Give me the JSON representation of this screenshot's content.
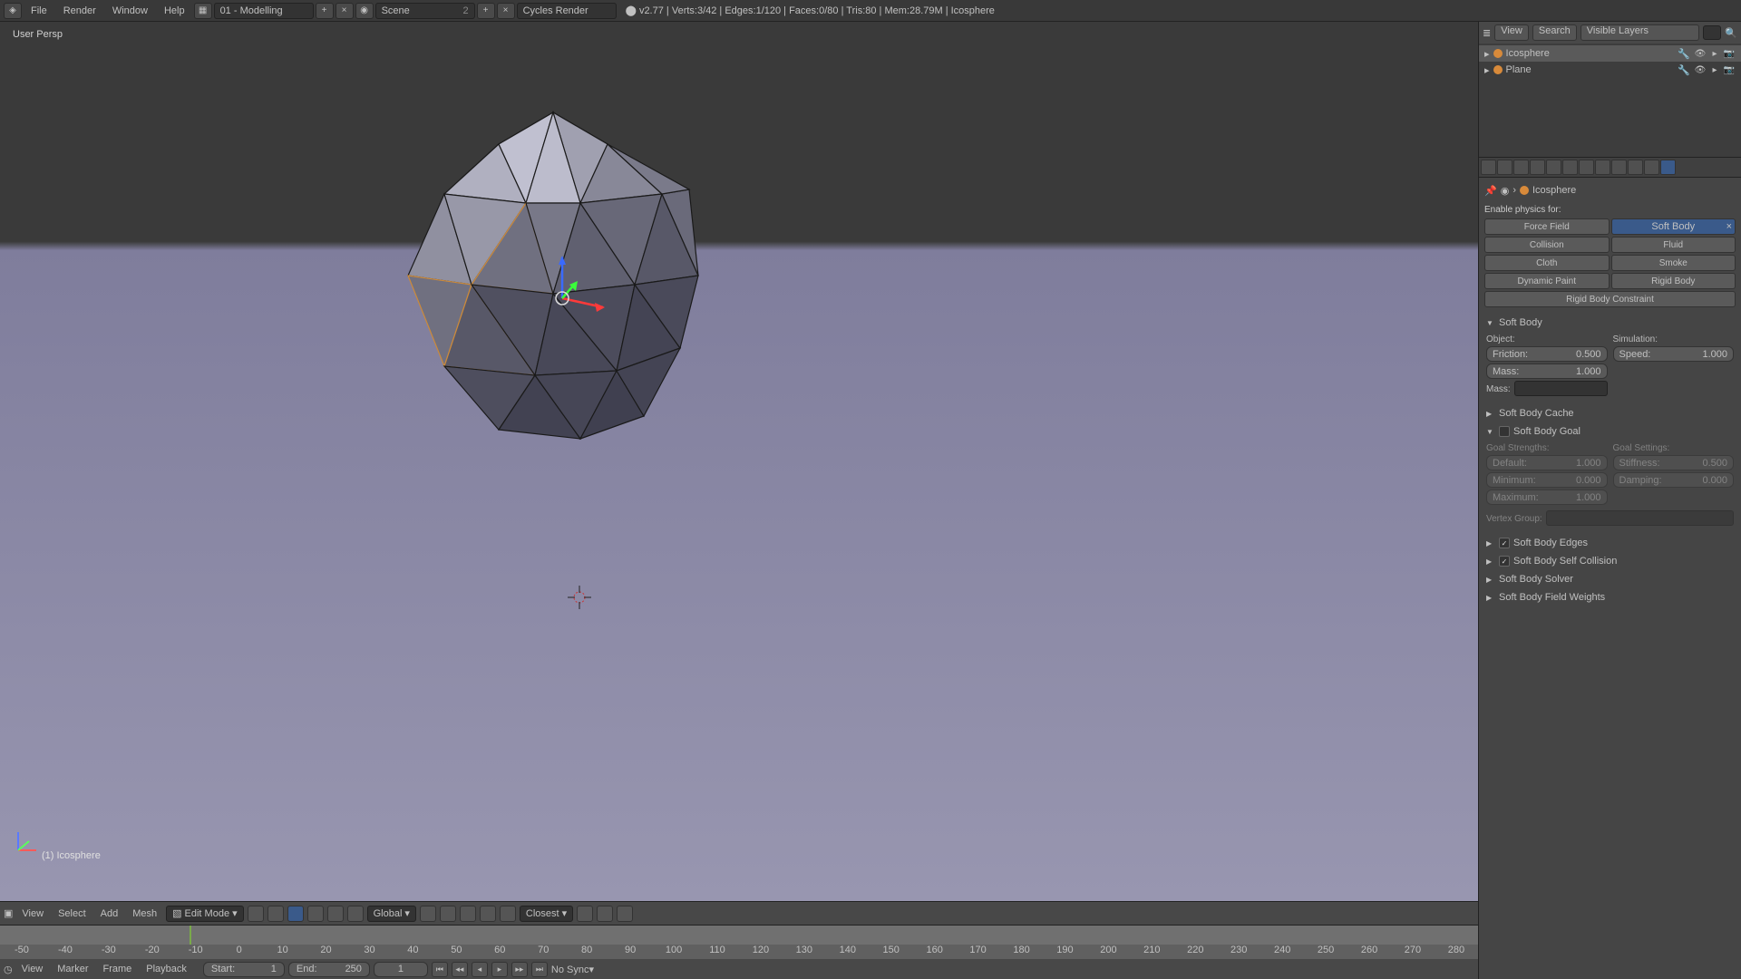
{
  "topbar": {
    "menus": [
      "File",
      "Render",
      "Window",
      "Help"
    ],
    "layout": "01 - Modelling",
    "scene": "Scene",
    "scene_users": "2",
    "render_engine": "Cycles Render",
    "version": "v2.77",
    "stats": "Verts:3/42 | Edges:1/120 | Faces:0/80 | Tris:80 | Mem:28.79M | Icosphere"
  },
  "view3d": {
    "persp_label": "User Persp",
    "object_label": "(1) Icosphere",
    "header": {
      "menus": [
        "View",
        "Select",
        "Add",
        "Mesh"
      ],
      "mode": "Edit Mode",
      "orientation": "Global",
      "snap": "Closest"
    }
  },
  "timeline": {
    "ticks": [
      "-50",
      "-40",
      "-30",
      "-20",
      "-10",
      "0",
      "10",
      "20",
      "30",
      "40",
      "50",
      "60",
      "70",
      "80",
      "90",
      "100",
      "110",
      "120",
      "130",
      "140",
      "150",
      "160",
      "170",
      "180",
      "190",
      "200",
      "210",
      "220",
      "230",
      "240",
      "250",
      "260",
      "270",
      "280"
    ],
    "header": {
      "menus": [
        "View",
        "Marker",
        "Frame",
        "Playback"
      ],
      "start_label": "Start:",
      "start_value": "1",
      "end_label": "End:",
      "end_value": "250",
      "current_frame": "1",
      "sync": "No Sync"
    }
  },
  "outliner": {
    "header": {
      "view_btn": "View",
      "search_btn": "Search",
      "filter": "Visible Layers"
    },
    "items": [
      {
        "name": "Icosphere",
        "selected": true
      },
      {
        "name": "Plane",
        "selected": false
      }
    ]
  },
  "props": {
    "breadcrumb_obj": "Icosphere",
    "enable_label": "Enable physics for:",
    "buttons": {
      "force_field": "Force Field",
      "soft_body": "Soft Body",
      "collision": "Collision",
      "fluid": "Fluid",
      "cloth": "Cloth",
      "smoke": "Smoke",
      "dynamic_paint": "Dynamic Paint",
      "rigid_body": "Rigid Body",
      "rigid_body_constraint": "Rigid Body Constraint"
    },
    "soft_body": {
      "title": "Soft Body",
      "object_label": "Object:",
      "simulation_label": "Simulation:",
      "friction_label": "Friction:",
      "friction_value": "0.500",
      "mass_label": "Mass:",
      "mass_value": "1.000",
      "mass2_label": "Mass:",
      "speed_label": "Speed:",
      "speed_value": "1.000"
    },
    "cache": {
      "title": "Soft Body Cache"
    },
    "goal": {
      "title": "Soft Body Goal",
      "checked": false,
      "strengths_label": "Goal Strengths:",
      "settings_label": "Goal Settings:",
      "default_label": "Default:",
      "default_value": "1.000",
      "minimum_label": "Minimum:",
      "minimum_value": "0.000",
      "maximum_label": "Maximum:",
      "maximum_value": "1.000",
      "stiffness_label": "Stiffness:",
      "stiffness_value": "0.500",
      "damping_label": "Damping:",
      "damping_value": "0.000",
      "vgroup_label": "Vertex Group:"
    },
    "edges": {
      "title": "Soft Body Edges",
      "checked": true
    },
    "self_collision": {
      "title": "Soft Body Self Collision",
      "checked": true
    },
    "solver": {
      "title": "Soft Body Solver"
    },
    "weights": {
      "title": "Soft Body Field Weights"
    }
  }
}
